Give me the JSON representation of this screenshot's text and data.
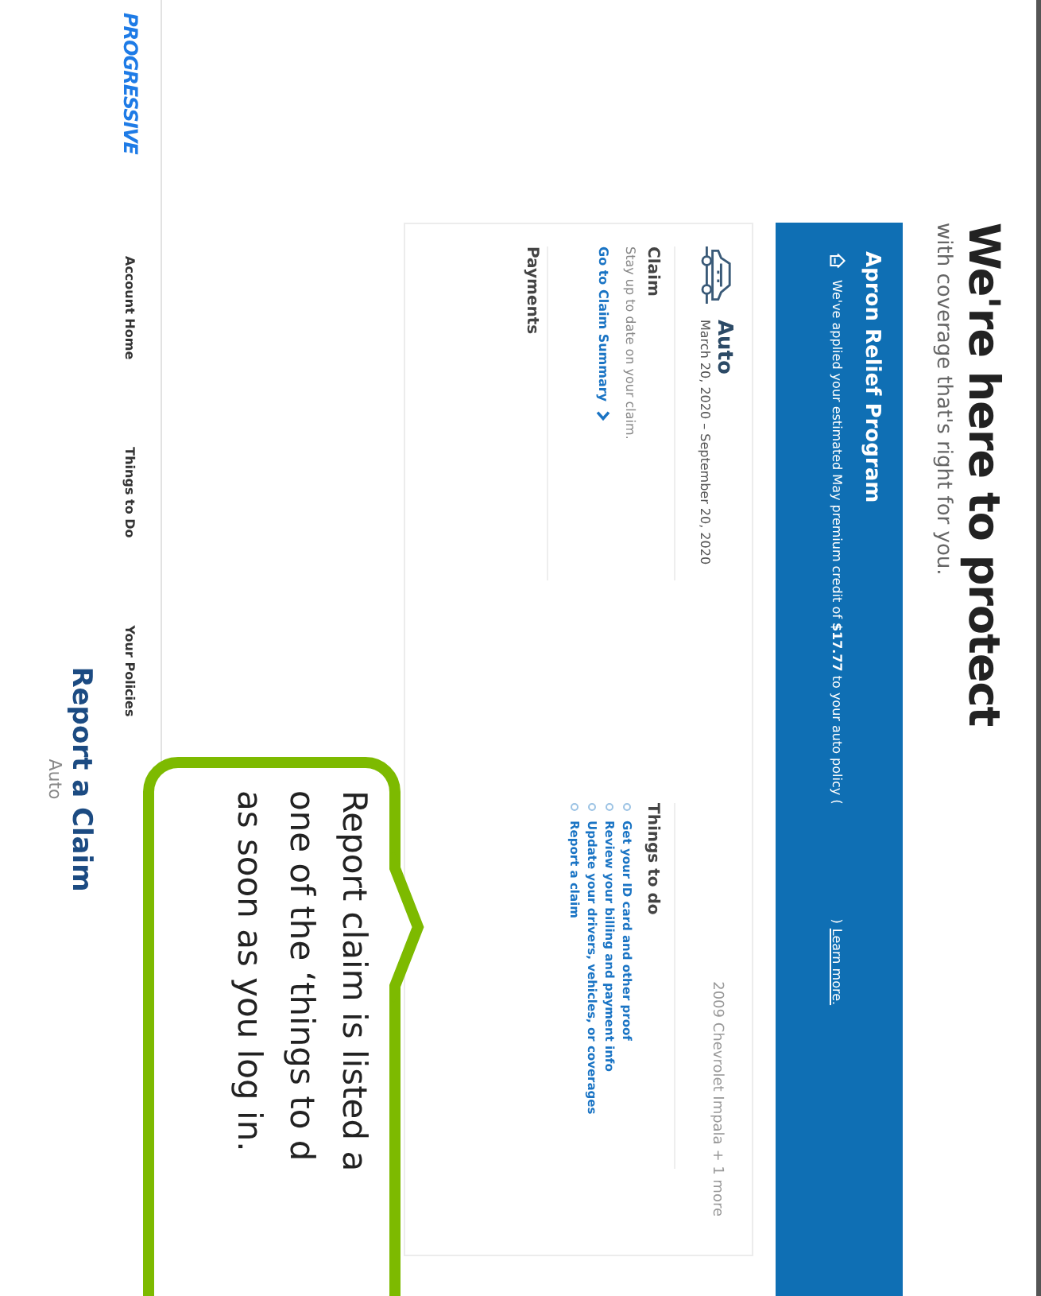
{
  "hero": {
    "title": "We're here to protect",
    "subtitle": "with coverage that's right for you."
  },
  "banner": {
    "title": "Apron Relief Program",
    "message": "We've applied your estimated May premium credit of **$17.77** to your auto policy (",
    "separator": ")",
    "link": "Learn more."
  },
  "policy": {
    "name": "Auto",
    "dates": "March 20, 2020 – September 20, 2020",
    "vehicles": "2009 Chevrolet Impala + 1 more",
    "claim": {
      "title": "Claim",
      "text": "Stay up to date on your claim.",
      "link": "Go to Claim Summary"
    },
    "payments": {
      "title": "Payments"
    },
    "todo": {
      "title": "Things to do",
      "items": [
        "Get your ID card and other proof",
        "Review your billing and payment info",
        "Update your drivers, vehicles, or coverages",
        "Report a claim"
      ]
    }
  },
  "nav": {
    "logo": "PROGRESSIVE",
    "items": [
      {
        "label": "Account Home",
        "selected": false
      },
      {
        "label": "Things to Do",
        "selected": false
      },
      {
        "label": "Your Policies",
        "selected": false
      }
    ]
  },
  "footer": {
    "title": "Report a Claim",
    "subtitle": "Auto"
  },
  "callout": {
    "lines": [
      "Report claim is listed a",
      "one of the ‘things to d",
      "as soon as you log in."
    ]
  }
}
